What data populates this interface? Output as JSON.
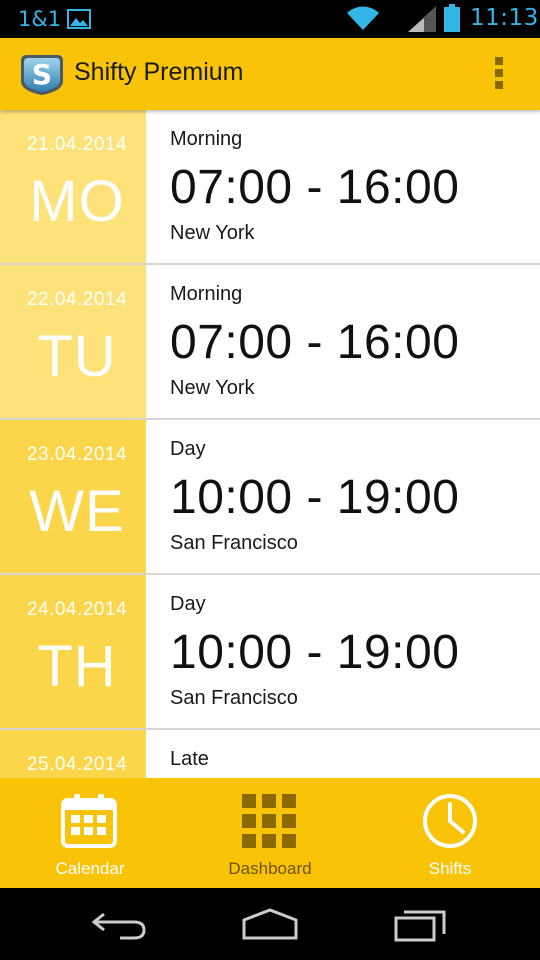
{
  "status_bar": {
    "carrier": "1&1",
    "clock": "11:13",
    "icons": [
      "gallery-icon",
      "wifi-icon",
      "signal-icon",
      "battery-icon"
    ]
  },
  "action_bar": {
    "title": "Shifty Premium",
    "logo_letter": "S",
    "overflow_icon": "overflow-menu-icon"
  },
  "colors": {
    "accent": "#f9c308",
    "date_col_light": "#fde27a",
    "date_col_dark": "#fcd64a",
    "status_text": "#33b5e5",
    "nav_inactive": "#8a6a00"
  },
  "shifts": [
    {
      "date": "21.04.2014",
      "day": "MO",
      "type": "Morning",
      "time": "07:00 - 16:00",
      "location": "New York"
    },
    {
      "date": "22.04.2014",
      "day": "TU",
      "type": "Morning",
      "time": "07:00 - 16:00",
      "location": "New York"
    },
    {
      "date": "23.04.2014",
      "day": "WE",
      "type": "Day",
      "time": "10:00 - 19:00",
      "location": "San Francisco"
    },
    {
      "date": "24.04.2014",
      "day": "TH",
      "type": "Day",
      "time": "10:00 - 19:00",
      "location": "San Francisco"
    },
    {
      "date": "25.04.2014",
      "day": "",
      "type": "Late",
      "time": "",
      "location": ""
    }
  ],
  "bottom_nav": {
    "items": [
      {
        "label": "Calendar",
        "icon": "calendar-icon",
        "active": true
      },
      {
        "label": "Dashboard",
        "icon": "dashboard-grid-icon",
        "active": false
      },
      {
        "label": "Shifts",
        "icon": "clock-icon",
        "active": true
      }
    ]
  },
  "system_nav": {
    "icons": [
      "back-icon",
      "home-icon",
      "recent-apps-icon"
    ]
  }
}
